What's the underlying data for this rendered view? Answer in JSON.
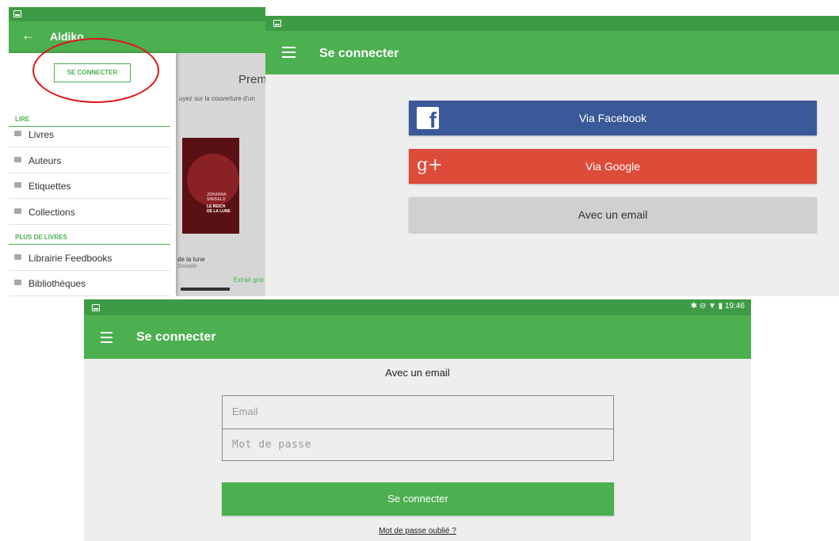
{
  "screen1": {
    "app_title": "Aldiko",
    "login_button": "SE CONNECTER",
    "section_read": "LIRE",
    "read_items": [
      {
        "label": "Livres",
        "icon": "book-icon"
      },
      {
        "label": "Auteurs",
        "icon": "person-icon"
      },
      {
        "label": "Etiquettes",
        "icon": "tag-icon"
      },
      {
        "label": "Collections",
        "icon": "collection-icon"
      }
    ],
    "section_more": "PLUS DE LIVRES",
    "more_items": [
      {
        "label": "Librairie Feedbooks",
        "icon": "store-icon"
      },
      {
        "label": "Bibliothèques",
        "icon": "library-icon"
      }
    ],
    "behind": {
      "heading": "Prem",
      "hint": "uyez sur la couverture d'un",
      "cover_author": "JOHANNA SINISALO",
      "cover_title_1": "LE REICH",
      "cover_title_2": "DE LA LUNE",
      "book_title": "de la lune",
      "book_author": "Sinisalo",
      "excerpt": "Extrait grat"
    }
  },
  "screen2": {
    "title": "Se connecter",
    "facebook_logo": "f",
    "facebook": "Via Facebook",
    "google_logo": "g+",
    "google": "Via Google",
    "email": "Avec un email"
  },
  "screen3": {
    "time": "19:46",
    "title": "Se connecter",
    "heading": "Avec un email",
    "email_placeholder": "Email",
    "password_placeholder": "Mot de passe",
    "submit": "Se connecter",
    "forgot": "Mot de passe oublié ?"
  },
  "colors": {
    "appbar": "#4caf50",
    "statusbar": "#3e9b45",
    "facebook": "#3b5998",
    "google": "#dd4b39",
    "highlight_circle": "#e0141a"
  }
}
